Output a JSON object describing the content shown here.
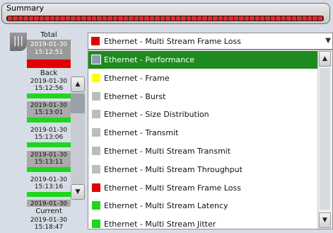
{
  "summary": {
    "title": "Summary",
    "segment_color": "#e32b2b"
  },
  "timeline": {
    "total": {
      "label": "Total",
      "date": "2019-01-30",
      "time": "15:12:51",
      "status_color": "#e00000"
    },
    "back_label": "Back",
    "entries": [
      {
        "date": "2019-01-30",
        "time": "15:12:56",
        "status_color": "#1ed61e"
      },
      {
        "date": "2019-01-30",
        "time": "15:13:01",
        "status_color": "#1ed61e"
      },
      {
        "date": "2019-01-30",
        "time": "15:13:06",
        "status_color": "#1ed61e"
      },
      {
        "date": "2019-01-30",
        "time": "15:13:11",
        "status_color": "#1ed61e"
      },
      {
        "date": "2019-01-30",
        "time": "15:13:16",
        "status_color": "#1ed61e"
      }
    ],
    "partial_entry": {
      "date": "2019-01-30"
    },
    "current": {
      "label": "Current",
      "date": "2019-01-30",
      "time": "15:18:47"
    }
  },
  "dropdown": {
    "selected": {
      "label": "Ethernet - Multi Stream Frame Loss",
      "color": "#e00000"
    },
    "options": [
      {
        "label": "Ethernet - Performance",
        "color": "#8d9bb0",
        "selected": true
      },
      {
        "label": "Ethernet - Frame",
        "color": "#ffff00",
        "selected": false
      },
      {
        "label": "Ethernet - Burst",
        "color": "#bcbcbc",
        "selected": false
      },
      {
        "label": "Ethernet - Size Distribution",
        "color": "#bcbcbc",
        "selected": false
      },
      {
        "label": "Ethernet - Transmit",
        "color": "#bcbcbc",
        "selected": false
      },
      {
        "label": "Ethernet - Multi Stream Transmit",
        "color": "#bcbcbc",
        "selected": false
      },
      {
        "label": "Ethernet - Multi Stream Throughput",
        "color": "#bcbcbc",
        "selected": false
      },
      {
        "label": "Ethernet - Multi Stream Frame Loss",
        "color": "#e00000",
        "selected": false
      },
      {
        "label": "Ethernet - Multi Stream Latency",
        "color": "#1ed61e",
        "selected": false
      },
      {
        "label": "Ethernet - Multi Stream Jitter",
        "color": "#1ed61e",
        "selected": false
      }
    ]
  },
  "icons": {
    "handle": "grip-icon",
    "up": "arrow-up-icon",
    "down": "arrow-down-icon",
    "dropdown": "chevron-down-icon"
  }
}
